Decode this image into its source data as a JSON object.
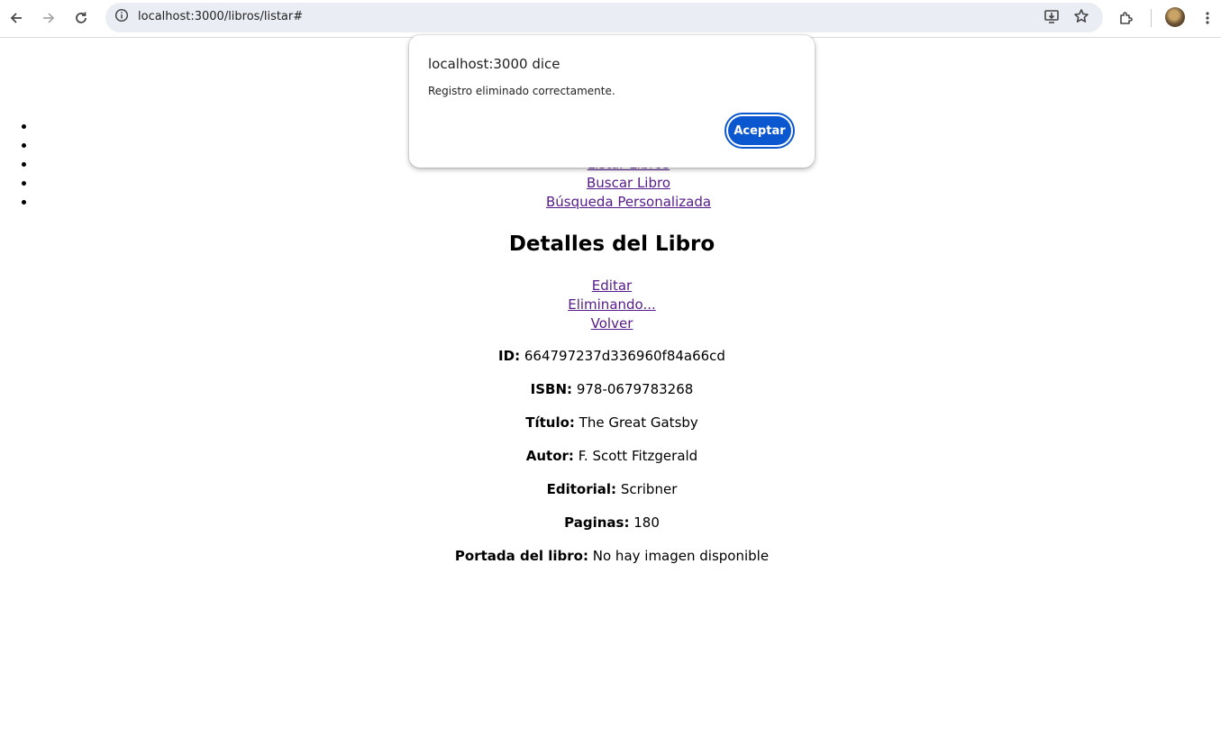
{
  "browser": {
    "url": "localhost:3000/libros/listar#",
    "icons": {
      "back": "arrow-left-icon",
      "forward": "arrow-right-icon",
      "reload": "reload-icon",
      "site_info": "info-icon",
      "install": "install-app-icon",
      "bookmark": "star-icon",
      "extensions": "puzzle-icon",
      "profile": "avatar",
      "menu": "kebab-menu-icon"
    }
  },
  "nav": {
    "items": [
      {
        "label": ""
      },
      {
        "label": ""
      },
      {
        "label": "Listar Libros"
      },
      {
        "label": "Buscar Libro"
      },
      {
        "label": "Búsqueda Personalizada"
      }
    ]
  },
  "details": {
    "title": "Detalles del Libro",
    "actions": {
      "edit": "Editar",
      "delete": "Eliminando...",
      "back": "Volver"
    },
    "fields": [
      {
        "label": "ID:",
        "value": "664797237d336960f84a66cd"
      },
      {
        "label": "ISBN:",
        "value": "978-0679783268"
      },
      {
        "label": "Título:",
        "value": "The Great Gatsby"
      },
      {
        "label": "Autor:",
        "value": "F. Scott Fitzgerald"
      },
      {
        "label": "Editorial:",
        "value": "Scribner"
      },
      {
        "label": "Paginas:",
        "value": "180"
      },
      {
        "label": "Portada del libro:",
        "value": "No hay imagen disponible"
      }
    ]
  },
  "dialog": {
    "title": "localhost:3000 dice",
    "message": "Registro eliminado correctamente.",
    "ok_label": "Aceptar"
  },
  "colors": {
    "link_visited": "#551a8b",
    "dialog_button": "#0b57d0",
    "omnibox_bg": "#eaedf4"
  }
}
